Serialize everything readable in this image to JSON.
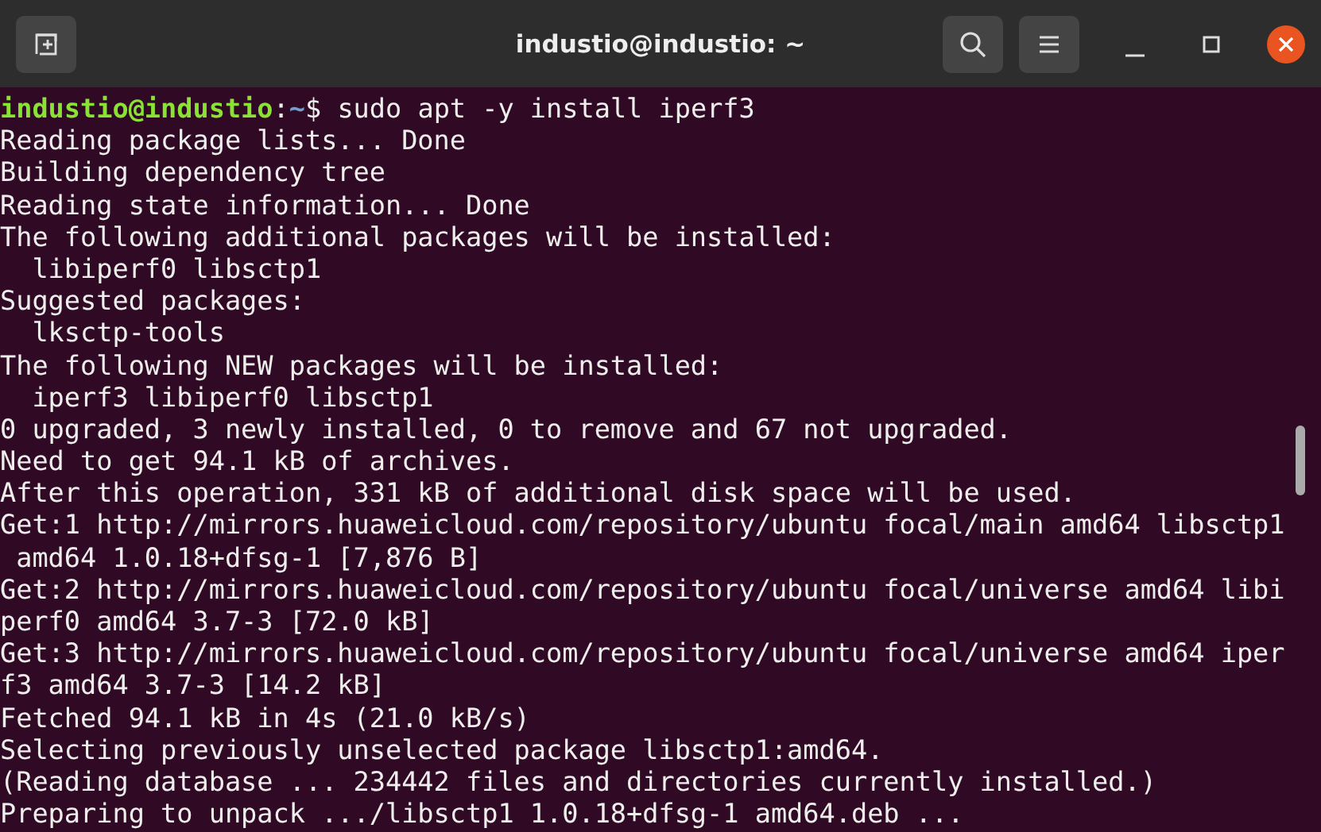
{
  "window": {
    "title": "industio@industio: ~"
  },
  "prompt": {
    "user_host": "industio@industio",
    "separator": ":",
    "path": "~",
    "symbol": "$",
    "command": " sudo apt -y install iperf3"
  },
  "output_lines": [
    "Reading package lists... Done",
    "Building dependency tree",
    "Reading state information... Done",
    "The following additional packages will be installed:",
    "  libiperf0 libsctp1",
    "Suggested packages:",
    "  lksctp-tools",
    "The following NEW packages will be installed:",
    "  iperf3 libiperf0 libsctp1",
    "0 upgraded, 3 newly installed, 0 to remove and 67 not upgraded.",
    "Need to get 94.1 kB of archives.",
    "After this operation, 331 kB of additional disk space will be used.",
    "Get:1 http://mirrors.huaweicloud.com/repository/ubuntu focal/main amd64 libsctp1",
    " amd64 1.0.18+dfsg-1 [7,876 B]",
    "Get:2 http://mirrors.huaweicloud.com/repository/ubuntu focal/universe amd64 libi",
    "perf0 amd64 3.7-3 [72.0 kB]",
    "Get:3 http://mirrors.huaweicloud.com/repository/ubuntu focal/universe amd64 iper",
    "f3 amd64 3.7-3 [14.2 kB]",
    "Fetched 94.1 kB in 4s (21.0 kB/s)",
    "Selecting previously unselected package libsctp1:amd64.",
    "(Reading database ... 234442 files and directories currently installed.)",
    "Preparing to unpack .../libsctp1 1.0.18+dfsg-1 amd64.deb ..."
  ]
}
